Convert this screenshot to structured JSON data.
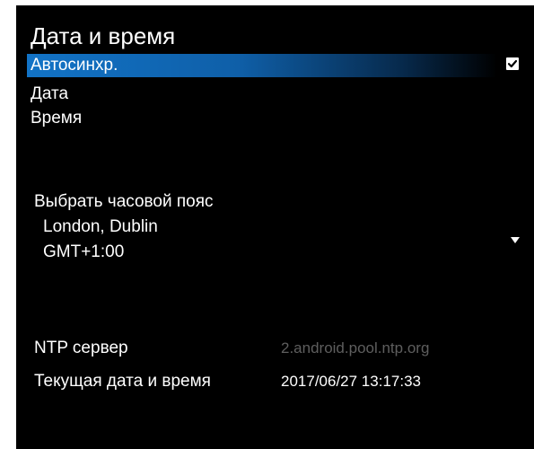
{
  "title": "Дата и время",
  "menu": {
    "autosync_label": "Автосинхр.",
    "autosync_checked": true,
    "date_label": "Дата",
    "time_label": "Время"
  },
  "timezone": {
    "label": "Выбрать часовой пояс",
    "city": "London, Dublin",
    "offset": "GMT+1:00"
  },
  "ntp": {
    "label": "NTP сервер",
    "value": "2.android.pool.ntp.org"
  },
  "current": {
    "label": "Текущая дата и время",
    "value": "2017/06/27 13:17:33"
  },
  "colors": {
    "background": "#000000",
    "highlight": "#1273c6",
    "text": "#ffffff",
    "disabled_text": "#5e5e5e"
  },
  "icons": {
    "checkbox": "checkbox-checked-icon",
    "dropdown": "chevron-down-icon"
  }
}
